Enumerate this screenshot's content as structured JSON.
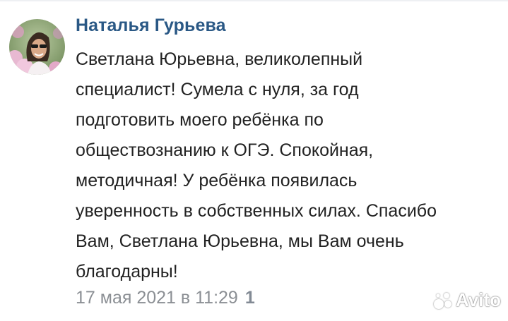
{
  "comment": {
    "author": "Наталья Гурьева",
    "text_lines": [
      "Светлана Юрьевна, великолепный",
      "специалист! Сумела с нуля, за год",
      "подготовить моего ребёнка по",
      "обществознанию к ОГЭ. Спокойная,",
      "методичная! У ребёнка появилась",
      "уверенность в собственных силах. Спасибо",
      "Вам, Светлана Юрьевна, мы Вам очень",
      "благодарны!"
    ],
    "date": "17 мая 2021 в 11:29",
    "likes": "1"
  },
  "watermark": {
    "label": "Avito",
    "icon": "avito-logo-icon"
  },
  "colors": {
    "author": "#2a5885",
    "text": "#222222",
    "meta": "#8b8f94"
  }
}
